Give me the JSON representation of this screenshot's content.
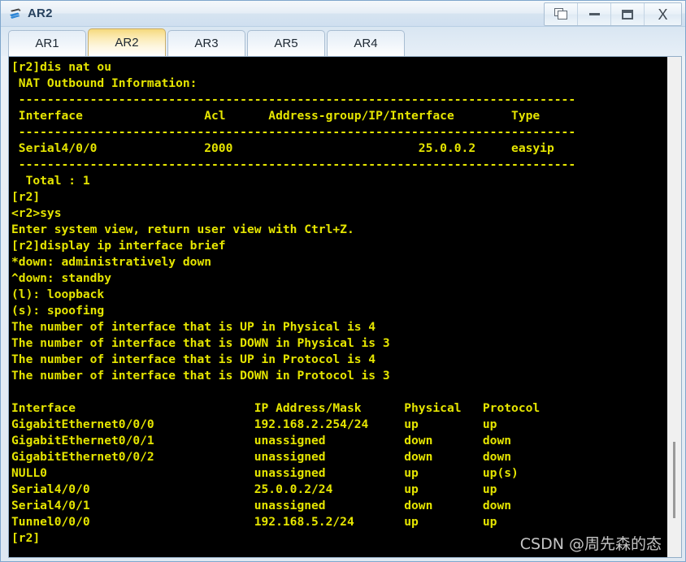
{
  "window": {
    "title": "AR2",
    "icon": "router-icon",
    "controls": [
      {
        "name": "restore-button",
        "label": "",
        "icon": "restore-icon"
      },
      {
        "name": "minimize-button",
        "label": "",
        "icon": "minimize-icon"
      },
      {
        "name": "maximize-button",
        "label": "",
        "icon": "maximize-icon"
      },
      {
        "name": "close-button",
        "label": "X",
        "icon": "close-icon"
      }
    ]
  },
  "tabs": [
    {
      "label": "AR1",
      "active": false
    },
    {
      "label": "AR2",
      "active": true
    },
    {
      "label": "AR3",
      "active": false
    },
    {
      "label": "AR5",
      "active": false
    },
    {
      "label": "AR4",
      "active": false
    }
  ],
  "terminal": {
    "foreground": "#e5e500",
    "background": "#000000",
    "lines": [
      "[r2]dis nat ou",
      " NAT Outbound Information:",
      " ------------------------------------------------------------------------------",
      " Interface                 Acl      Address-group/IP/Interface        Type",
      " ------------------------------------------------------------------------------",
      " Serial4/0/0               2000                          25.0.0.2     easyip",
      " ------------------------------------------------------------------------------",
      "  Total : 1",
      "[r2]",
      "<r2>sys",
      "Enter system view, return user view with Ctrl+Z.",
      "[r2]display ip interface brief",
      "*down: administratively down",
      "^down: standby",
      "(l): loopback",
      "(s): spoofing",
      "The number of interface that is UP in Physical is 4",
      "The number of interface that is DOWN in Physical is 3",
      "The number of interface that is UP in Protocol is 4",
      "The number of interface that is DOWN in Protocol is 3",
      "",
      "Interface                         IP Address/Mask      Physical   Protocol",
      "GigabitEthernet0/0/0              192.168.2.254/24     up         up",
      "GigabitEthernet0/0/1              unassigned           down       down",
      "GigabitEthernet0/0/2              unassigned           down       down",
      "NULL0                             unassigned           up         up(s)",
      "Serial4/0/0                       25.0.0.2/24          up         up",
      "Serial4/0/1                       unassigned           down       down",
      "Tunnel0/0/0                       192.168.5.2/24       up         up",
      "[r2]"
    ],
    "nat_outbound": {
      "title": "NAT Outbound Information:",
      "headers": [
        "Interface",
        "Acl",
        "Address-group/IP/Interface",
        "Type"
      ],
      "rows": [
        [
          "Serial4/0/0",
          "2000",
          "25.0.0.2",
          "easyip"
        ]
      ],
      "total_label": "Total : 1"
    },
    "ip_interface_brief": {
      "command": "display ip interface brief",
      "legend": [
        "*down: administratively down",
        "^down: standby",
        "(l): loopback",
        "(s): spoofing"
      ],
      "counters": [
        "The number of interface that is UP in Physical is 4",
        "The number of interface that is DOWN in Physical is 3",
        "The number of interface that is UP in Protocol is 4",
        "The number of interface that is DOWN in Protocol is 3"
      ],
      "headers": [
        "Interface",
        "IP Address/Mask",
        "Physical",
        "Protocol"
      ],
      "rows": [
        [
          "GigabitEthernet0/0/0",
          "192.168.2.254/24",
          "up",
          "up"
        ],
        [
          "GigabitEthernet0/0/1",
          "unassigned",
          "down",
          "down"
        ],
        [
          "GigabitEthernet0/0/2",
          "unassigned",
          "down",
          "down"
        ],
        [
          "NULL0",
          "unassigned",
          "up",
          "up(s)"
        ],
        [
          "Serial4/0/0",
          "25.0.0.2/24",
          "up",
          "up"
        ],
        [
          "Serial4/0/1",
          "unassigned",
          "down",
          "down"
        ],
        [
          "Tunnel0/0/0",
          "192.168.5.2/24",
          "up",
          "up"
        ]
      ]
    }
  },
  "watermark": "CSDN @周先森的态",
  "colors": {
    "terminal_text": "#e5e500",
    "terminal_bg": "#000000",
    "active_tab": "#f5d97d",
    "frame_border": "#7ea6cc",
    "title_text": "#26415e"
  }
}
